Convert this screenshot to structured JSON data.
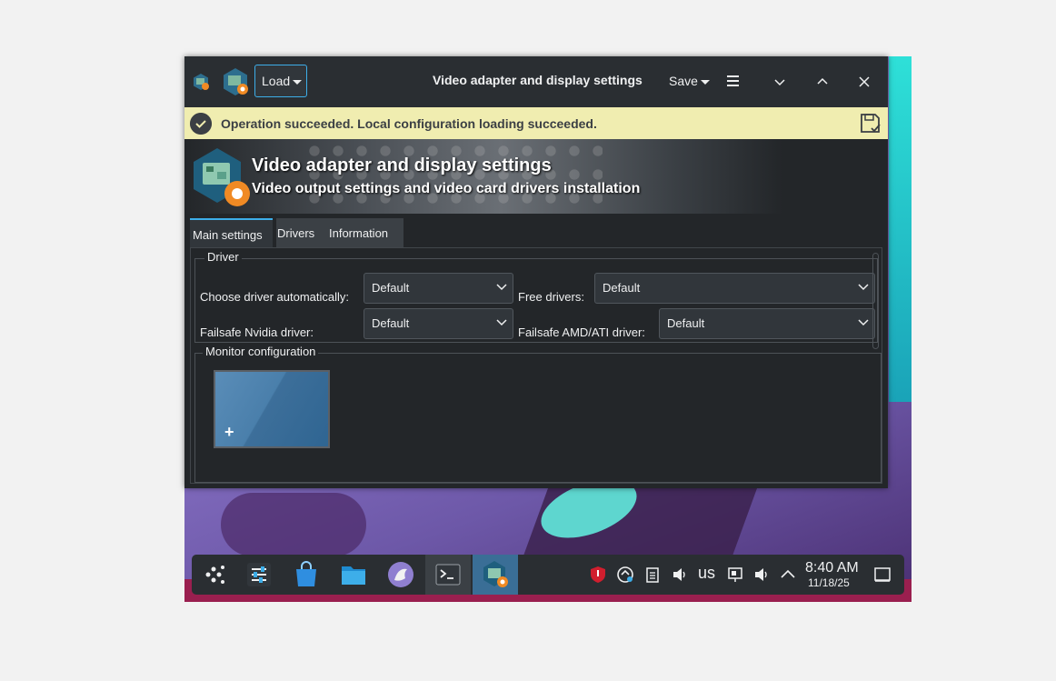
{
  "window": {
    "title": "Video adapter and display settings",
    "load_label": "Load",
    "save_label": "Save"
  },
  "banner": {
    "message": "Operation succeeded. Local configuration loading succeeded."
  },
  "header": {
    "title": "Video adapter and display settings",
    "subtitle": "Video output settings and video card drivers installation"
  },
  "tabs": [
    {
      "label": "Main settings"
    },
    {
      "label": "Drivers"
    },
    {
      "label": "Information"
    }
  ],
  "driver_group": {
    "title": "Driver",
    "choose_auto_label": "Choose driver automatically:",
    "choose_auto_value": "Default",
    "free_drivers_label": "Free drivers:",
    "free_drivers_value": "Default",
    "failsafe_nvidia_label": "Failsafe Nvidia driver:",
    "failsafe_nvidia_value": "Default",
    "failsafe_amd_label": "Failsafe AMD/ATI driver:",
    "failsafe_amd_value": "Default"
  },
  "monitor_group": {
    "title": "Monitor configuration",
    "add_symbol": "+"
  },
  "taskbar": {
    "keyboard_layout": "us",
    "time": "8:40 AM",
    "date": "11/18/25"
  },
  "colors": {
    "accent": "#3daee9",
    "banner_bg": "#f0edb0",
    "window_bg": "#232629"
  }
}
